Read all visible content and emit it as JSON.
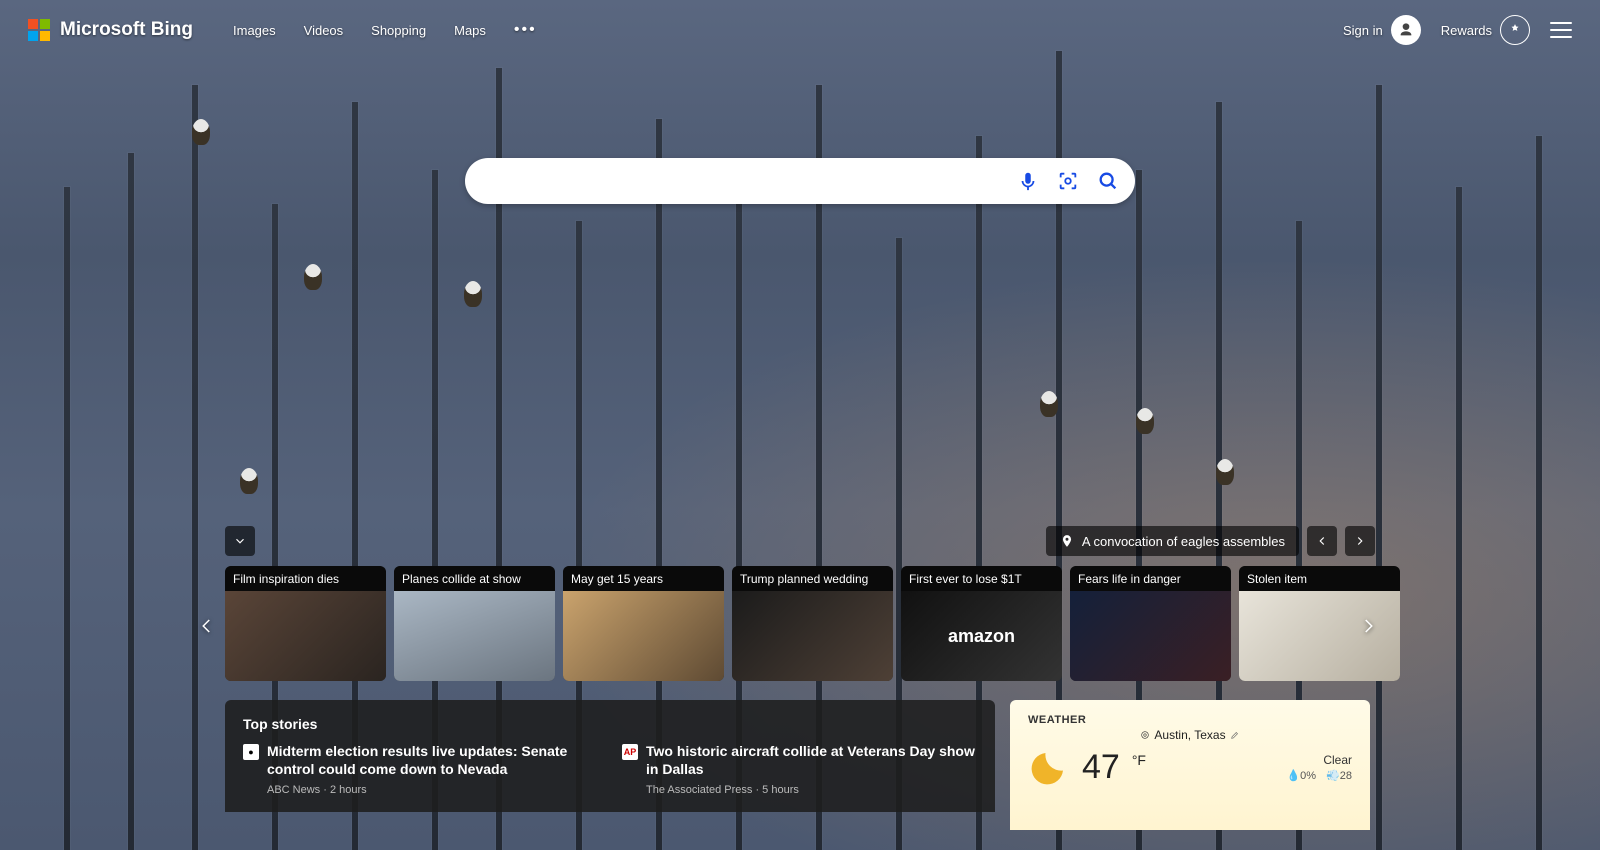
{
  "brand": {
    "name": "Microsoft Bing"
  },
  "nav": {
    "links": [
      "Images",
      "Videos",
      "Shopping",
      "Maps"
    ],
    "signin": "Sign in",
    "rewards": "Rewards"
  },
  "search": {
    "placeholder": ""
  },
  "image_info": {
    "caption": "A convocation of eagles assembles"
  },
  "carousel": {
    "items": [
      {
        "title": "Film inspiration dies",
        "gradient": "linear-gradient(135deg,#5a4538,#2a2420)"
      },
      {
        "title": "Planes collide at show",
        "gradient": "linear-gradient(160deg,#aab7c4,#6b7580)"
      },
      {
        "title": "May get 15 years",
        "gradient": "linear-gradient(135deg,#caa36d,#5e4a33)"
      },
      {
        "title": "Trump planned wedding",
        "gradient": "linear-gradient(135deg,#1b1b1b,#4e4036)"
      },
      {
        "title": "First ever to lose $1T",
        "gradient": "linear-gradient(135deg,#111,#333)"
      },
      {
        "title": "Fears life in danger",
        "gradient": "linear-gradient(135deg,#14203a,#3a1f24)"
      },
      {
        "title": "Stolen item",
        "gradient": "linear-gradient(135deg,#e8e4da,#b6afa0)"
      }
    ]
  },
  "top_stories": {
    "heading": "Top stories",
    "items": [
      {
        "badge": "",
        "headline": "Midterm election results live updates: Senate control could come down to Nevada",
        "source": "ABC News",
        "time": "2 hours"
      },
      {
        "badge": "AP",
        "headline": "Two historic aircraft collide at Veterans Day show in Dallas",
        "source": "The Associated Press",
        "time": "5 hours"
      }
    ]
  },
  "weather": {
    "heading": "WEATHER",
    "location": "Austin, Texas",
    "temp": "47",
    "unit": "°F",
    "condition": "Clear",
    "precip": "0%",
    "wind": "28"
  }
}
